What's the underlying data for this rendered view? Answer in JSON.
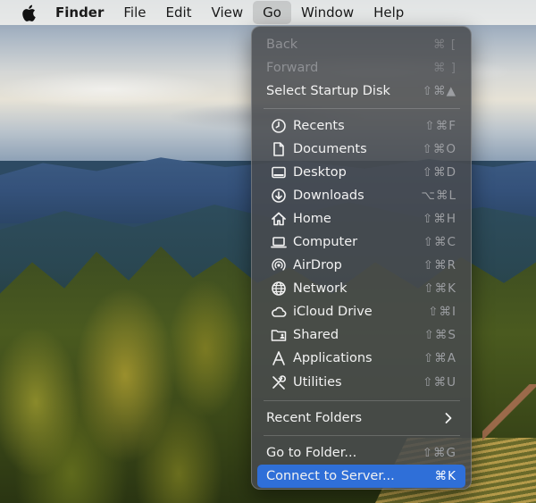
{
  "menubar": {
    "items": [
      {
        "label": "Finder"
      },
      {
        "label": "File"
      },
      {
        "label": "Edit"
      },
      {
        "label": "View"
      },
      {
        "label": "Go"
      },
      {
        "label": "Window"
      },
      {
        "label": "Help"
      }
    ]
  },
  "go_menu": {
    "items": [
      {
        "label": "Back",
        "shortcut": "⌘ [",
        "state": "disabled"
      },
      {
        "label": "Forward",
        "shortcut": "⌘ ]",
        "state": "disabled"
      },
      {
        "label": "Select Startup Disk",
        "shortcut": "⇧⌘▲"
      },
      {
        "label": "Recents",
        "shortcut": "⇧⌘F",
        "icon": "clock-icon"
      },
      {
        "label": "Documents",
        "shortcut": "⇧⌘O",
        "icon": "document-icon"
      },
      {
        "label": "Desktop",
        "shortcut": "⇧⌘D",
        "icon": "desktop-icon"
      },
      {
        "label": "Downloads",
        "shortcut": "⌥⌘L",
        "icon": "download-icon"
      },
      {
        "label": "Home",
        "shortcut": "⇧⌘H",
        "icon": "home-icon"
      },
      {
        "label": "Computer",
        "shortcut": "⇧⌘C",
        "icon": "laptop-icon"
      },
      {
        "label": "AirDrop",
        "shortcut": "⇧⌘R",
        "icon": "airdrop-icon"
      },
      {
        "label": "Network",
        "shortcut": "⇧⌘K",
        "icon": "globe-icon"
      },
      {
        "label": "iCloud Drive",
        "shortcut": "⇧⌘I",
        "icon": "cloud-icon"
      },
      {
        "label": "Shared",
        "shortcut": "⇧⌘S",
        "icon": "shared-folder-icon"
      },
      {
        "label": "Applications",
        "shortcut": "⇧⌘A",
        "icon": "applications-icon"
      },
      {
        "label": "Utilities",
        "shortcut": "⇧⌘U",
        "icon": "utilities-icon"
      },
      {
        "label": "Recent Folders",
        "submenu": true
      },
      {
        "label": "Go to Folder...",
        "shortcut": "⇧⌘G"
      },
      {
        "label": "Connect to Server...",
        "shortcut": "⌘K",
        "state": "selected"
      }
    ]
  },
  "colors": {
    "menu_background": "#484a4e",
    "selection": "#2f6fd8",
    "menu_text": "#f2f2f2",
    "shortcut_text": "#9c9ea2",
    "disabled_text": "#8e9094"
  }
}
